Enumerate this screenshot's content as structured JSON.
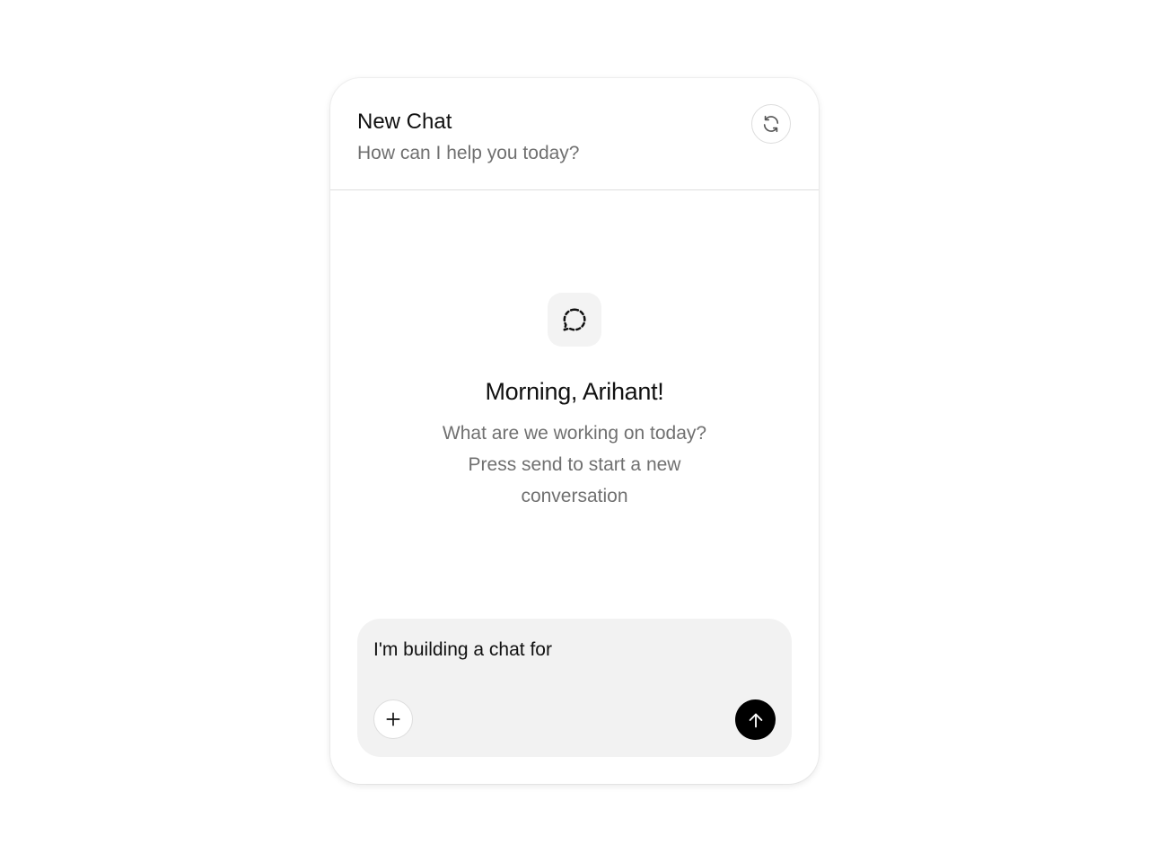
{
  "header": {
    "title": "New Chat",
    "subtitle": "How can I help you today?",
    "refresh_icon": "refresh-icon"
  },
  "empty_state": {
    "icon": "dashed-chat-bubble-icon",
    "greeting": "Morning, Arihant!",
    "prompt": "What are we working on today? Press send to start a new conversation"
  },
  "composer": {
    "value": "I'm building a chat for",
    "add_icon": "plus-icon",
    "send_icon": "arrow-up-icon"
  },
  "colors": {
    "send_button": "#000000",
    "composer_bg": "#f2f2f2",
    "muted_text": "#707070"
  }
}
